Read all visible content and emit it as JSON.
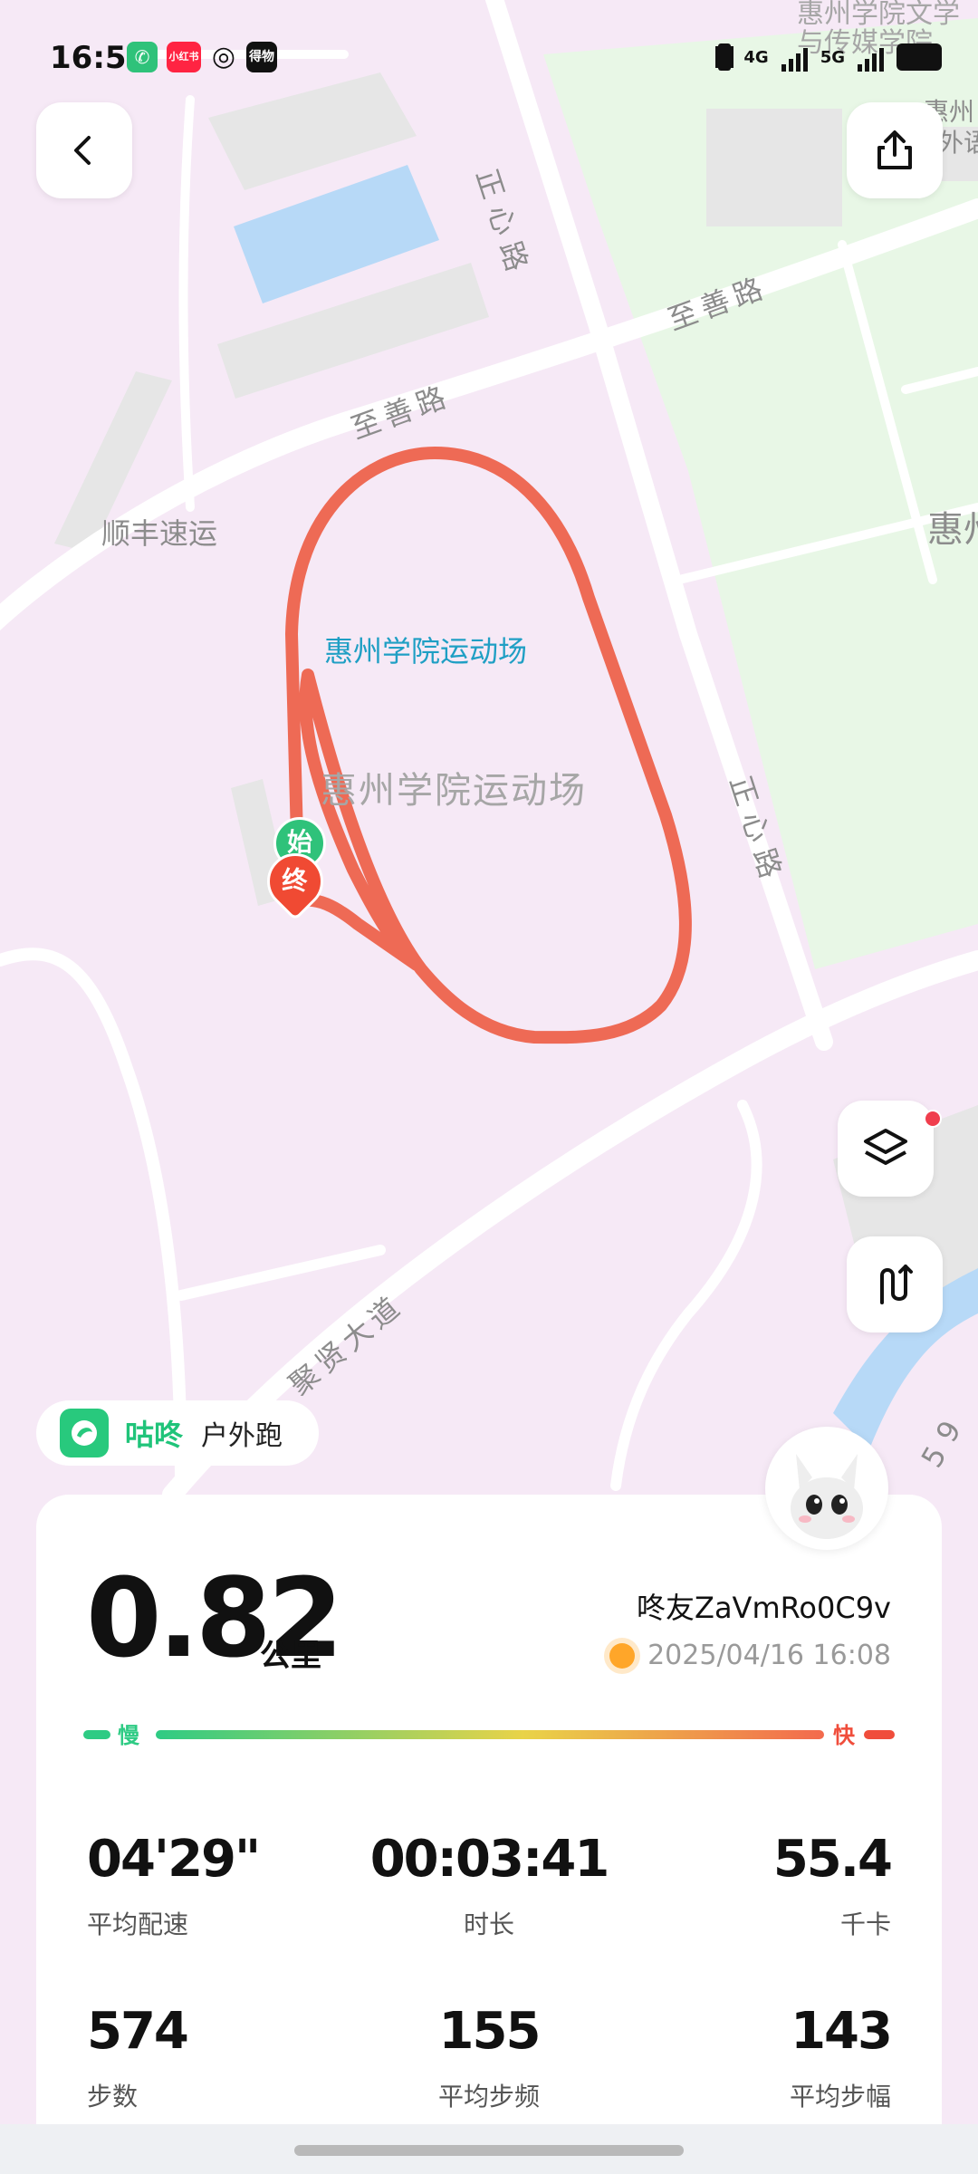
{
  "status_bar": {
    "time": "16:55",
    "app_icons": [
      "phone-call-app-icon",
      "xiaohongshu-app-icon",
      "netease-music-app-icon",
      "dewu-app-icon"
    ],
    "app_icon_texts": [
      "",
      "小红书",
      "",
      "得物"
    ],
    "network": [
      "4G",
      "5G"
    ]
  },
  "map": {
    "labels": {
      "stadium_poi": "惠州学院运动场",
      "stadium_area": "惠州学院运动场",
      "road_zhishan_1": "至善路",
      "road_zhishan_2": "至善路",
      "road_zhengxin_1": "正心路",
      "road_zhengxin_2": "正心路",
      "road_juxian": "聚贤大道",
      "shunfeng": "顺丰速运",
      "college_top": "惠州学院文学与传媒学院",
      "college_right": "惠州",
      "right_partial_1": "惠州",
      "right_partial_2": "外语",
      "bottom_right": "59"
    },
    "markers": {
      "start": "始",
      "end": "终"
    }
  },
  "brand": {
    "name": "咕咚",
    "sport": "户外跑"
  },
  "summary": {
    "distance": "0.82",
    "distance_unit": "公里",
    "user": "咚友ZaVmRo0C9v",
    "datetime": "2025/04/16  16:08",
    "pace_slow_label": "慢",
    "pace_fast_label": "快"
  },
  "stats": [
    {
      "value": "04'29\"",
      "label": "平均配速"
    },
    {
      "value": "00:03:41",
      "label": "时长"
    },
    {
      "value": "55.4",
      "label": "千卡"
    },
    {
      "value": "574",
      "label": "步数"
    },
    {
      "value": "155",
      "label": "平均步频"
    },
    {
      "value": "143",
      "label": "平均步幅"
    }
  ],
  "colors": {
    "route": "#ee6a55",
    "accent_green": "#28c97d",
    "map_bg": "#f6e9f6",
    "campus_green": "#e8f7e6"
  }
}
